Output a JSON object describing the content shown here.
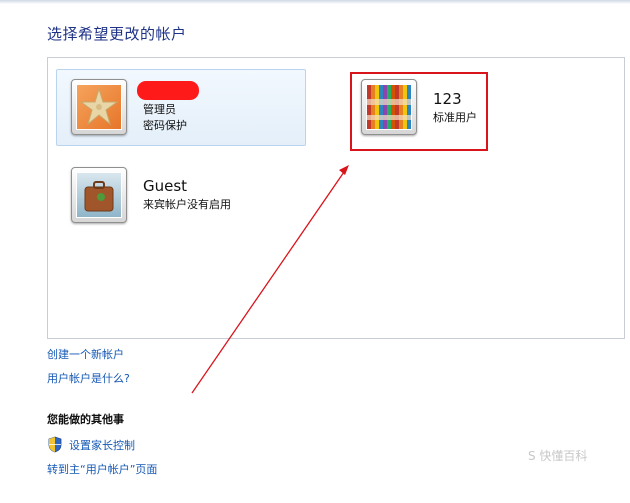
{
  "heading": "选择希望更改的帐户",
  "accounts": [
    {
      "name": "",
      "lines": [
        "管理员",
        "密码保护"
      ],
      "picture": "starfish-picture",
      "selected": true
    },
    {
      "name": "123",
      "lines": [
        "标准用户"
      ],
      "picture": "crayons-picture",
      "selected": false
    },
    {
      "name": "Guest",
      "lines": [
        "来宾帐户没有启用"
      ],
      "picture": "suitcase-picture",
      "selected": false
    }
  ],
  "links": {
    "create_account": "创建一个新帐户",
    "what_is_account": "用户帐户是什么?"
  },
  "other_tasks": {
    "heading": "您能做的其他事",
    "parental_controls": "设置家长控制",
    "go_main": "转到主“用户帐户”页面"
  },
  "watermark": "S 快懂百科",
  "colors": {
    "heading": "#1e3287",
    "link": "#1558b5",
    "annotation_red": "#d9141b"
  }
}
